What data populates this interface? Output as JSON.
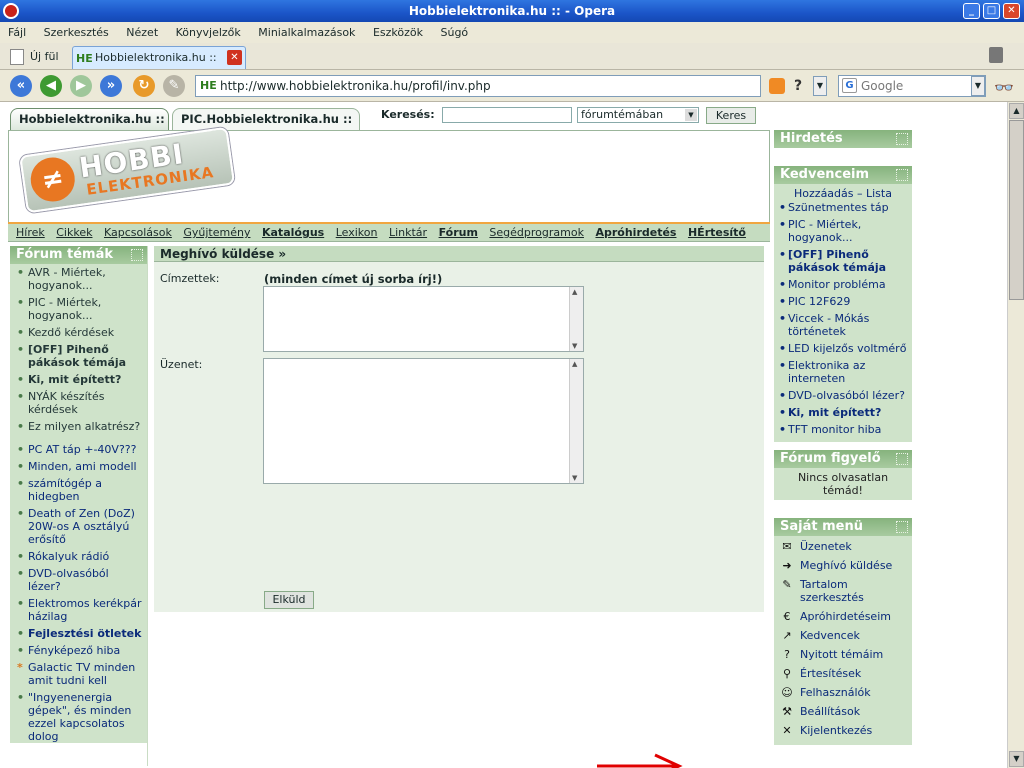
{
  "window": {
    "title": "Hobbielektronika.hu :: - Opera"
  },
  "menubar": [
    "Fájl",
    "Szerkesztés",
    "Nézet",
    "Könyvjelzők",
    "Minialkalmazások",
    "Eszközök",
    "Súgó"
  ],
  "tabs": {
    "new_tab": "Új fül",
    "active_tab": "Hobbielektronika.hu ::",
    "favicon": "HE"
  },
  "toolbar": {
    "url": "http://www.hobbielektronika.hu/profil/inv.php",
    "favicon": "HE",
    "search_placeholder": "Google"
  },
  "site_tabs": [
    "Hobbielektronika.hu ::",
    "PIC.Hobbielektronika.hu ::"
  ],
  "site_search": {
    "label": "Keresés:",
    "scope": "fórumtémában",
    "button": "Keres"
  },
  "logo": {
    "line1": "HOBBI",
    "line2": "ELEKTRONIKA"
  },
  "nav": [
    {
      "label": "Hírek",
      "bold": false
    },
    {
      "label": "Cikkek",
      "bold": false
    },
    {
      "label": "Kapcsolások",
      "bold": false
    },
    {
      "label": "Gyűjtemény",
      "bold": false
    },
    {
      "label": "Katalógus",
      "bold": true
    },
    {
      "label": "Lexikon",
      "bold": false
    },
    {
      "label": "Linktár",
      "bold": false
    },
    {
      "label": "Fórum",
      "bold": true
    },
    {
      "label": "Segédprogramok",
      "bold": false
    },
    {
      "label": "Apróhirdetés",
      "bold": true
    },
    {
      "label": "HÉrtesítő",
      "bold": true
    }
  ],
  "forum_topics": {
    "title": "Fórum témák",
    "group1": [
      {
        "label": "AVR - Miértek, hogyanok...",
        "style": ""
      },
      {
        "label": "PIC - Miértek, hogyanok...",
        "style": ""
      },
      {
        "label": "Kezdő kérdések",
        "style": ""
      },
      {
        "label": "[OFF] Pihenő pákások témája",
        "style": "bold"
      },
      {
        "label": "Ki, mit épített?",
        "style": "bold"
      },
      {
        "label": "NYÁK készítés kérdések",
        "style": ""
      },
      {
        "label": "Ez milyen alkatrész?",
        "style": ""
      }
    ],
    "group2": [
      {
        "label": "PC AT táp +-40V???",
        "style": "blue"
      },
      {
        "label": "Minden, ami modell",
        "style": "blue"
      },
      {
        "label": "számítógép a hidegben",
        "style": "blue"
      },
      {
        "label": "Death of Zen (DoZ) 20W-os A osztályú erősítő",
        "style": "blue"
      },
      {
        "label": "Rókalyuk rádió",
        "style": "blue"
      },
      {
        "label": "DVD-olvasóból lézer?",
        "style": "blue"
      },
      {
        "label": "Elektromos kerékpár házilag",
        "style": "blue"
      },
      {
        "label": "Fejlesztési ötletek",
        "style": "blue bold"
      },
      {
        "label": "Fényképező hiba",
        "style": "blue"
      },
      {
        "label": "Galactic TV minden amit tudni kell",
        "style": "blue star"
      },
      {
        "label": "\"Ingyenenergia gépek\", és minden ezzel kapcsolatos dolog",
        "style": "blue"
      }
    ]
  },
  "invite_form": {
    "title": "Meghívó küldése »",
    "recipients_label": "Címzettek:",
    "hint": "(minden címet új sorba írj!)",
    "recipients_value": "",
    "message_label": "Üzenet:",
    "message_value": "",
    "submit": "Elküld"
  },
  "right_panels": {
    "ads_title": "Hirdetés",
    "favorites": {
      "title": "Kedvenceim",
      "add_link": "Hozzáadás – Lista",
      "items": [
        {
          "label": "Szünetmentes táp",
          "bold": false
        },
        {
          "label": "PIC - Miértek, hogyanok...",
          "bold": false
        },
        {
          "label": "[OFF] Pihenő pákások témája",
          "bold": true
        },
        {
          "label": "Monitor probléma",
          "bold": false
        },
        {
          "label": "PIC 12F629",
          "bold": false
        },
        {
          "label": "Viccek - Mókás történetek",
          "bold": false
        },
        {
          "label": "LED kijelzős voltmérő",
          "bold": false
        },
        {
          "label": "Elektronika az interneten",
          "bold": false
        },
        {
          "label": "DVD-olvasóból lézer?",
          "bold": false
        },
        {
          "label": "Ki, mit épített?",
          "bold": true
        },
        {
          "label": "TFT monitor hiba",
          "bold": false
        }
      ]
    },
    "watch": {
      "title": "Fórum figyelő",
      "note": "Nincs olvasatlan témád!"
    },
    "my_menu": {
      "title": "Saját menü",
      "items": [
        {
          "label": "Üzenetek",
          "icon": "envelope-icon",
          "glyph": "✉"
        },
        {
          "label": "Meghívó küldése",
          "icon": "invite-icon",
          "glyph": "➜"
        },
        {
          "label": "Tartalom szerkesztés",
          "icon": "edit-icon",
          "glyph": "✎"
        },
        {
          "label": "Apróhirdetéseim",
          "icon": "euro-icon",
          "glyph": "€"
        },
        {
          "label": "Kedvencek",
          "icon": "bookmark-icon",
          "glyph": "↗"
        },
        {
          "label": "Nyitott témáim",
          "icon": "question-icon",
          "glyph": "?"
        },
        {
          "label": "Értesítések",
          "icon": "magnifier-icon",
          "glyph": "⚲"
        },
        {
          "label": "Felhasználók",
          "icon": "user-icon",
          "glyph": "☺"
        },
        {
          "label": "Beállítások",
          "icon": "tools-icon",
          "glyph": "⚒"
        },
        {
          "label": "Kijelentkezés",
          "icon": "exit-icon",
          "glyph": "✕"
        }
      ]
    }
  },
  "colors": {
    "accent_green": "#a8cba0",
    "panel_green": "#cfe3ca",
    "link_blue": "#0a2a7a",
    "orange": "#e87722",
    "arrow_red": "#e00000"
  }
}
